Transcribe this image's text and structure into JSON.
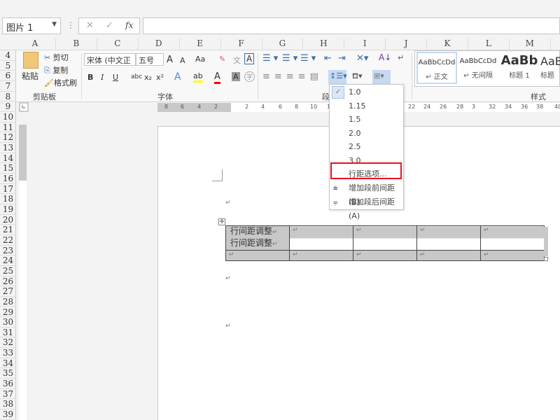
{
  "name_box": "图片 1",
  "formula_icons": [
    "cancel-icon",
    "enter-icon",
    "fx-icon"
  ],
  "formula_labels": {
    "cancel": "✕",
    "enter": "✓",
    "fx": "fx"
  },
  "columns": [
    "A",
    "B",
    "C",
    "D",
    "E",
    "F",
    "G",
    "H",
    "I",
    "J",
    "K",
    "L",
    "M"
  ],
  "rows": [
    "4",
    "5",
    "6",
    "7",
    "8",
    "9",
    "10",
    "11",
    "12",
    "13",
    "14",
    "15",
    "16",
    "17",
    "18",
    "19",
    "20",
    "21",
    "22",
    "23",
    "24",
    "25",
    "26",
    "27",
    "28",
    "29",
    "30",
    "31",
    "32",
    "33",
    "34",
    "35",
    "36",
    "37",
    "38",
    "39"
  ],
  "ribbon": {
    "clipboard": {
      "paste": "粘贴",
      "cut": "剪切",
      "copy": "复制",
      "format_painter": "格式刷",
      "label": "剪贴板"
    },
    "font": {
      "font_name": "宋体 (中文正文",
      "font_size": "五号",
      "label": "字体",
      "bold": "B",
      "italic": "I",
      "underline": "U",
      "strike": "abc",
      "sub": "x₂",
      "sup": "x²",
      "grow": "A",
      "shrink": "A",
      "case": "Aa",
      "pinyin": "文",
      "border_char": "A",
      "shade_char": "A",
      "enclose": "字"
    },
    "paragraph": {
      "label": "段"
    },
    "styles": {
      "items": [
        {
          "preview": "AaBbCcDd",
          "name": "↵ 正文"
        },
        {
          "preview": "AaBbCcDd",
          "name": "↵ 无间隔"
        },
        {
          "preview": "AaBb",
          "name": "标题 1"
        },
        {
          "preview": "AaB",
          "name": "标题"
        }
      ],
      "label": "样式"
    }
  },
  "ruler": [
    "8",
    "6",
    "4",
    "2",
    "2",
    "4",
    "6",
    "8",
    "10",
    "12",
    "22",
    "24",
    "26",
    "28",
    "3",
    "32",
    "34",
    "36",
    "38",
    "40"
  ],
  "line_spacing_menu": {
    "options": [
      "1.0",
      "1.15",
      "1.5",
      "2.0",
      "2.5",
      "3.0"
    ],
    "selected": "1.0",
    "more": "行距选项...",
    "add_before": "增加段前间距(B)",
    "add_after": "增加段后间距(A)"
  },
  "table": {
    "cell1_line1": "行间距调整",
    "cell1_line2": "行间距调整",
    "mark": "↵"
  },
  "paragraph_mark": "↵",
  "colors": {
    "highlight_box": "#e81123",
    "accent": "#c5d9f1"
  }
}
